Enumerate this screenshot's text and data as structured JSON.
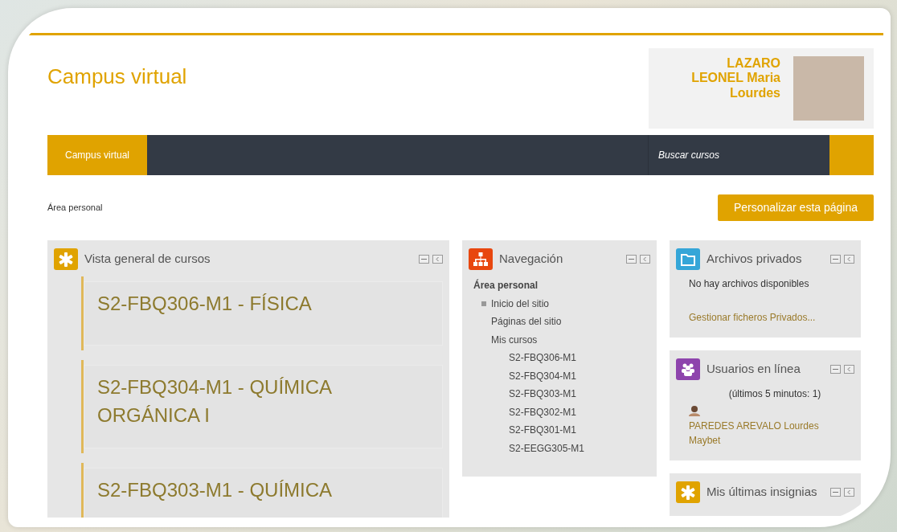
{
  "site_title": "Campus virtual",
  "user": {
    "name": "LAZARO LEONEL Maria Lourdes"
  },
  "navbar": {
    "items": [
      {
        "label": "Campus virtual",
        "selected": true
      }
    ],
    "search": {
      "placeholder": "Buscar cursos"
    }
  },
  "breadcrumb": "Área personal",
  "customize_button": "Personalizar esta página",
  "course_overview": {
    "title": "Vista general de cursos",
    "color": "#e0a300",
    "courses": [
      {
        "title": "S2-FBQ306-M1 - FÍSICA"
      },
      {
        "title": "S2-FBQ304-M1 - QUÍMICA ORGÁNICA I"
      },
      {
        "title": "S2-FBQ303-M1 - QUÍMICA"
      }
    ]
  },
  "navigation": {
    "title": "Navegación",
    "color": "#e8470f",
    "tree": [
      {
        "label": "Área personal",
        "bullet": false,
        "children": [
          {
            "label": "Inicio del sitio",
            "bullet": true
          },
          {
            "label": "Páginas del sitio",
            "bullet": false
          },
          {
            "label": "Mis cursos",
            "bullet": false,
            "children": [
              {
                "label": "S2-FBQ306-M1",
                "bullet": false
              },
              {
                "label": "S2-FBQ304-M1",
                "bullet": false
              },
              {
                "label": "S2-FBQ303-M1",
                "bullet": false
              },
              {
                "label": "S2-FBQ302-M1",
                "bullet": false
              },
              {
                "label": "S2-FBQ301-M1",
                "bullet": false
              },
              {
                "label": "S2-EEGG305-M1",
                "bullet": false
              }
            ]
          }
        ]
      }
    ]
  },
  "private_files": {
    "title": "Archivos privados",
    "color": "#35a6d8",
    "message": "No hay archivos disponibles",
    "link": "Gestionar ficheros Privados..."
  },
  "online_users": {
    "title": "Usuarios en línea",
    "color": "#8e44ad",
    "summary": "(últimos 5 minutos: 1)",
    "users": [
      {
        "name": "PAREDES AREVALO Lourdes Maybet"
      }
    ]
  },
  "badges": {
    "title": "Mis últimas insignias",
    "color": "#e0a300"
  }
}
